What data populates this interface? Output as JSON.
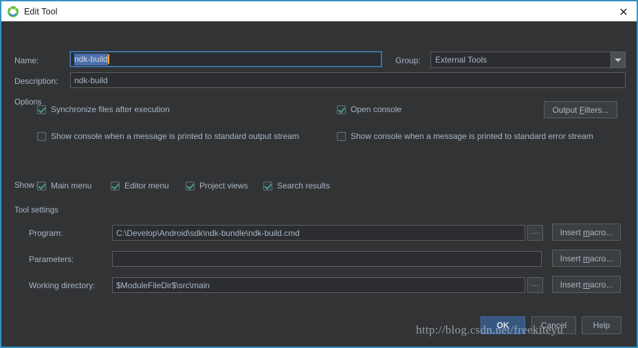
{
  "window": {
    "title": "Edit Tool",
    "icon": "android-robot-icon",
    "close_label": "✕",
    "accent_color": "#3592c4",
    "titlebar_bg": "#ffffff",
    "body_bg": "#313335",
    "text_color": "#a9b7c6",
    "selection_color": "#4b6eaf",
    "checkmark_color": "#4e9a92"
  },
  "form": {
    "name_label": "Name:",
    "name_value": "ndk-build",
    "name_selected": true,
    "group_label": "Group:",
    "group_value": "External Tools",
    "description_label": "Description:",
    "description_value": "ndk-build"
  },
  "options": {
    "section_label": "Options",
    "checkboxes": [
      {
        "label": "Synchronize files after execution",
        "checked": true
      },
      {
        "label": "Open console",
        "checked": true
      },
      {
        "label": "Show console when a message is printed to standard output stream",
        "checked": false
      },
      {
        "label": "Show console when a message is printed to standard error stream",
        "checked": false
      }
    ],
    "output_filters_button": "Output Filters...",
    "output_filters_mnemonic": "F"
  },
  "show_in": {
    "section_label": "Show in",
    "checkboxes": [
      {
        "label": "Main menu",
        "checked": true
      },
      {
        "label": "Editor menu",
        "checked": true
      },
      {
        "label": "Project views",
        "checked": true
      },
      {
        "label": "Search results",
        "checked": true
      }
    ]
  },
  "tool_settings": {
    "section_label": "Tool settings",
    "rows": [
      {
        "label": "Program:",
        "value": "C:\\Develop\\Android\\sdk\\ndk-bundle\\ndk-build.cmd",
        "browse_label": "...",
        "has_browse": true,
        "macro_label": "Insert macro...",
        "macro_mnemonic": "m"
      },
      {
        "label": "Parameters:",
        "value": "",
        "browse_label": "...",
        "has_browse": false,
        "macro_label": "Insert macro...",
        "macro_mnemonic": "m"
      },
      {
        "label": "Working directory:",
        "value": "$ModuleFileDir$\\src\\main",
        "browse_label": "...",
        "has_browse": true,
        "macro_label": "Insert macro...",
        "macro_mnemonic": "m"
      }
    ]
  },
  "footer": {
    "ok_label": "OK",
    "cancel_label": "Cancel",
    "help_label": "Help"
  },
  "watermark": {
    "text": "http://blog.csdn.net/freekiteyu"
  }
}
